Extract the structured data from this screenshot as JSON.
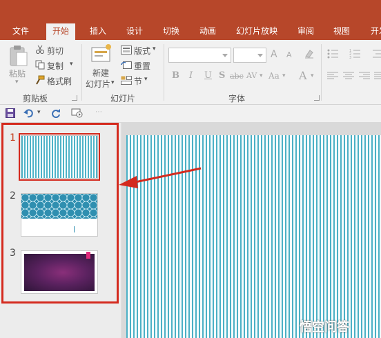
{
  "tabs": [
    "文件",
    "开始",
    "插入",
    "设计",
    "切换",
    "动画",
    "幻灯片放映",
    "审阅",
    "视图",
    "开发"
  ],
  "active_tab": "开始",
  "clipboard": {
    "paste": "粘贴",
    "cut": "剪切",
    "copy": "复制",
    "format_painter": "格式刷",
    "group": "剪贴板"
  },
  "slides_group": {
    "new_slide_line1": "新建",
    "new_slide_line2": "幻灯片",
    "layout": "版式",
    "reset": "重置",
    "section": "节",
    "group": "幻灯片"
  },
  "font_group": {
    "group": "字体",
    "bold": "B",
    "italic": "I",
    "underline": "U",
    "strike": "S",
    "strikethrough": "abc",
    "spacing": "AV",
    "case": "Aa",
    "font_color": "A",
    "grow": "A",
    "shrink": "A"
  },
  "thumbnails": [
    {
      "number": "1",
      "selected": true
    },
    {
      "number": "2",
      "selected": false
    },
    {
      "number": "3",
      "selected": false
    }
  ],
  "watermark": "悟空问答",
  "colors": {
    "ribbon_accent": "#b7472a",
    "highlight": "#d42a1e",
    "stripe": "#4bb0c5"
  }
}
